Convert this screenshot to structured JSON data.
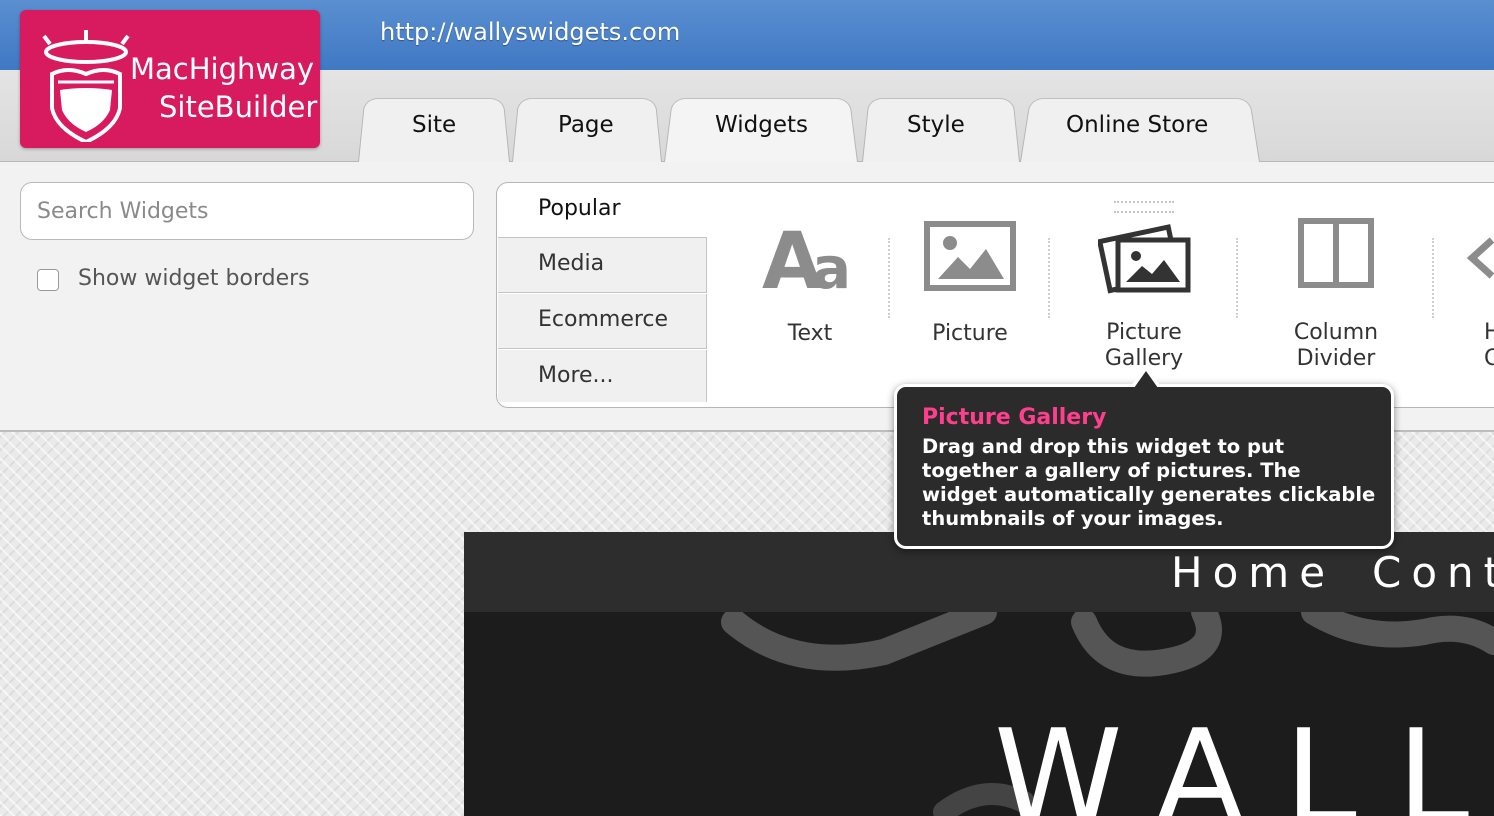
{
  "browser": {
    "url": "http://wallyswidgets.com"
  },
  "logo": {
    "line1": "MacHighway",
    "line2": "SiteBuilder"
  },
  "tabs": [
    {
      "label": "Site"
    },
    {
      "label": "Page"
    },
    {
      "label": "Widgets",
      "active": true
    },
    {
      "label": "Style"
    },
    {
      "label": "Online Store"
    }
  ],
  "search": {
    "placeholder": "Search Widgets"
  },
  "options": {
    "show_borders_label": "Show widget borders",
    "show_borders_checked": false
  },
  "categories": [
    {
      "label": "Popular",
      "active": true
    },
    {
      "label": "Media"
    },
    {
      "label": "Ecommerce"
    },
    {
      "label": "More..."
    }
  ],
  "widgets": [
    {
      "label": "Text",
      "icon": "text-aa-icon"
    },
    {
      "label": "Picture",
      "icon": "picture-icon"
    },
    {
      "label_line1": "Picture",
      "label_line2": "Gallery",
      "icon": "picture-gallery-icon"
    },
    {
      "label_line1": "Column",
      "label_line2": "Divider",
      "icon": "column-divider-icon"
    },
    {
      "label_line1": "H",
      "label_line2": "C",
      "icon": "chevron-left-icon"
    }
  ],
  "tooltip": {
    "title": "Picture Gallery",
    "body": "Drag and drop this widget to put together a gallery of pictures. The widget automatically generates clickable thumbnails of your images."
  },
  "site_preview": {
    "nav": [
      "Home",
      "Cont"
    ],
    "hero_text": "WALL"
  },
  "colors": {
    "brand_pink": "#d81b5f",
    "tooltip_title": "#ff3f8e",
    "topbar_blue": "#4a82c9"
  }
}
